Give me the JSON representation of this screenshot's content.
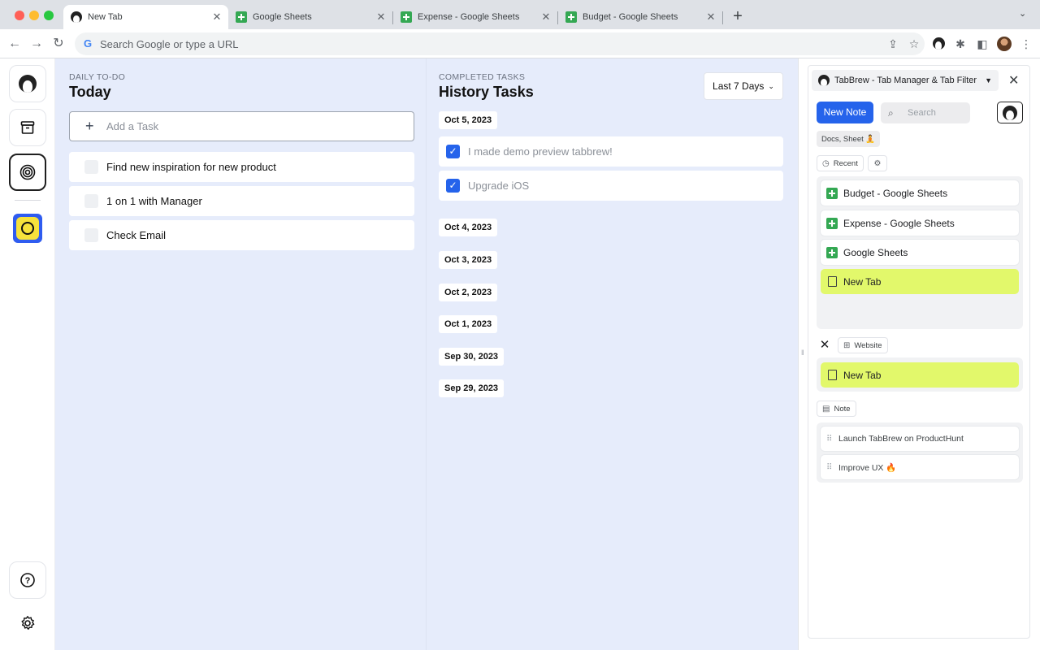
{
  "browser": {
    "tabs": [
      {
        "title": "New Tab",
        "icon": "tabbrew-face-icon",
        "active": true
      },
      {
        "title": "Google Sheets",
        "icon": "google-sheets-icon",
        "active": false
      },
      {
        "title": "Expense - Google Sheets",
        "icon": "google-sheets-icon",
        "active": false
      },
      {
        "title": "Budget - Google Sheets",
        "icon": "google-sheets-icon",
        "active": false
      }
    ],
    "omnibox_placeholder": "Search Google or type a URL"
  },
  "todo": {
    "eyebrow": "DAILY TO-DO",
    "title": "Today",
    "add_placeholder": "Add a Task",
    "items": [
      {
        "text": "Find new inspiration for new product",
        "done": false
      },
      {
        "text": "1 on 1 with Manager",
        "done": false
      },
      {
        "text": "Check Email",
        "done": false
      }
    ]
  },
  "history": {
    "eyebrow": "COMPLETED TASKS",
    "title": "History Tasks",
    "range_label": "Last 7 Days",
    "groups": [
      {
        "date": "Oct 5, 2023",
        "tasks": [
          "I made demo preview tabbrew!",
          "Upgrade iOS"
        ]
      },
      {
        "date": "Oct 4, 2023",
        "tasks": []
      },
      {
        "date": "Oct 3, 2023",
        "tasks": []
      },
      {
        "date": "Oct 2, 2023",
        "tasks": []
      },
      {
        "date": "Oct 1, 2023",
        "tasks": []
      },
      {
        "date": "Sep 30, 2023",
        "tasks": []
      },
      {
        "date": "Sep 29, 2023",
        "tasks": []
      }
    ]
  },
  "side_panel": {
    "extension_title": "TabBrew - Tab Manager & Tab Filter",
    "new_note_label": "New Note",
    "search_placeholder": "Search",
    "filter_chip": "Docs, Sheet 🧘",
    "recent_label": "Recent",
    "recent_tabs": [
      {
        "title": "Budget - Google Sheets",
        "icon": "google-sheets-icon",
        "current": false
      },
      {
        "title": "Expense - Google Sheets",
        "icon": "google-sheets-icon",
        "current": false
      },
      {
        "title": "Google Sheets",
        "icon": "google-sheets-icon",
        "current": false
      },
      {
        "title": "New Tab",
        "icon": "document-icon",
        "current": true
      }
    ],
    "website_label": "Website",
    "website_tabs": [
      {
        "title": "New Tab",
        "icon": "document-icon",
        "current": true
      }
    ],
    "note_label": "Note",
    "notes": [
      "Launch TabBrew on ProductHunt",
      "Improve UX 🔥"
    ]
  },
  "colors": {
    "accent": "#2563eb",
    "main_background": "#e6ecfb",
    "current_tab_highlight": "#e2f86b",
    "sheets_green": "#34a853"
  }
}
